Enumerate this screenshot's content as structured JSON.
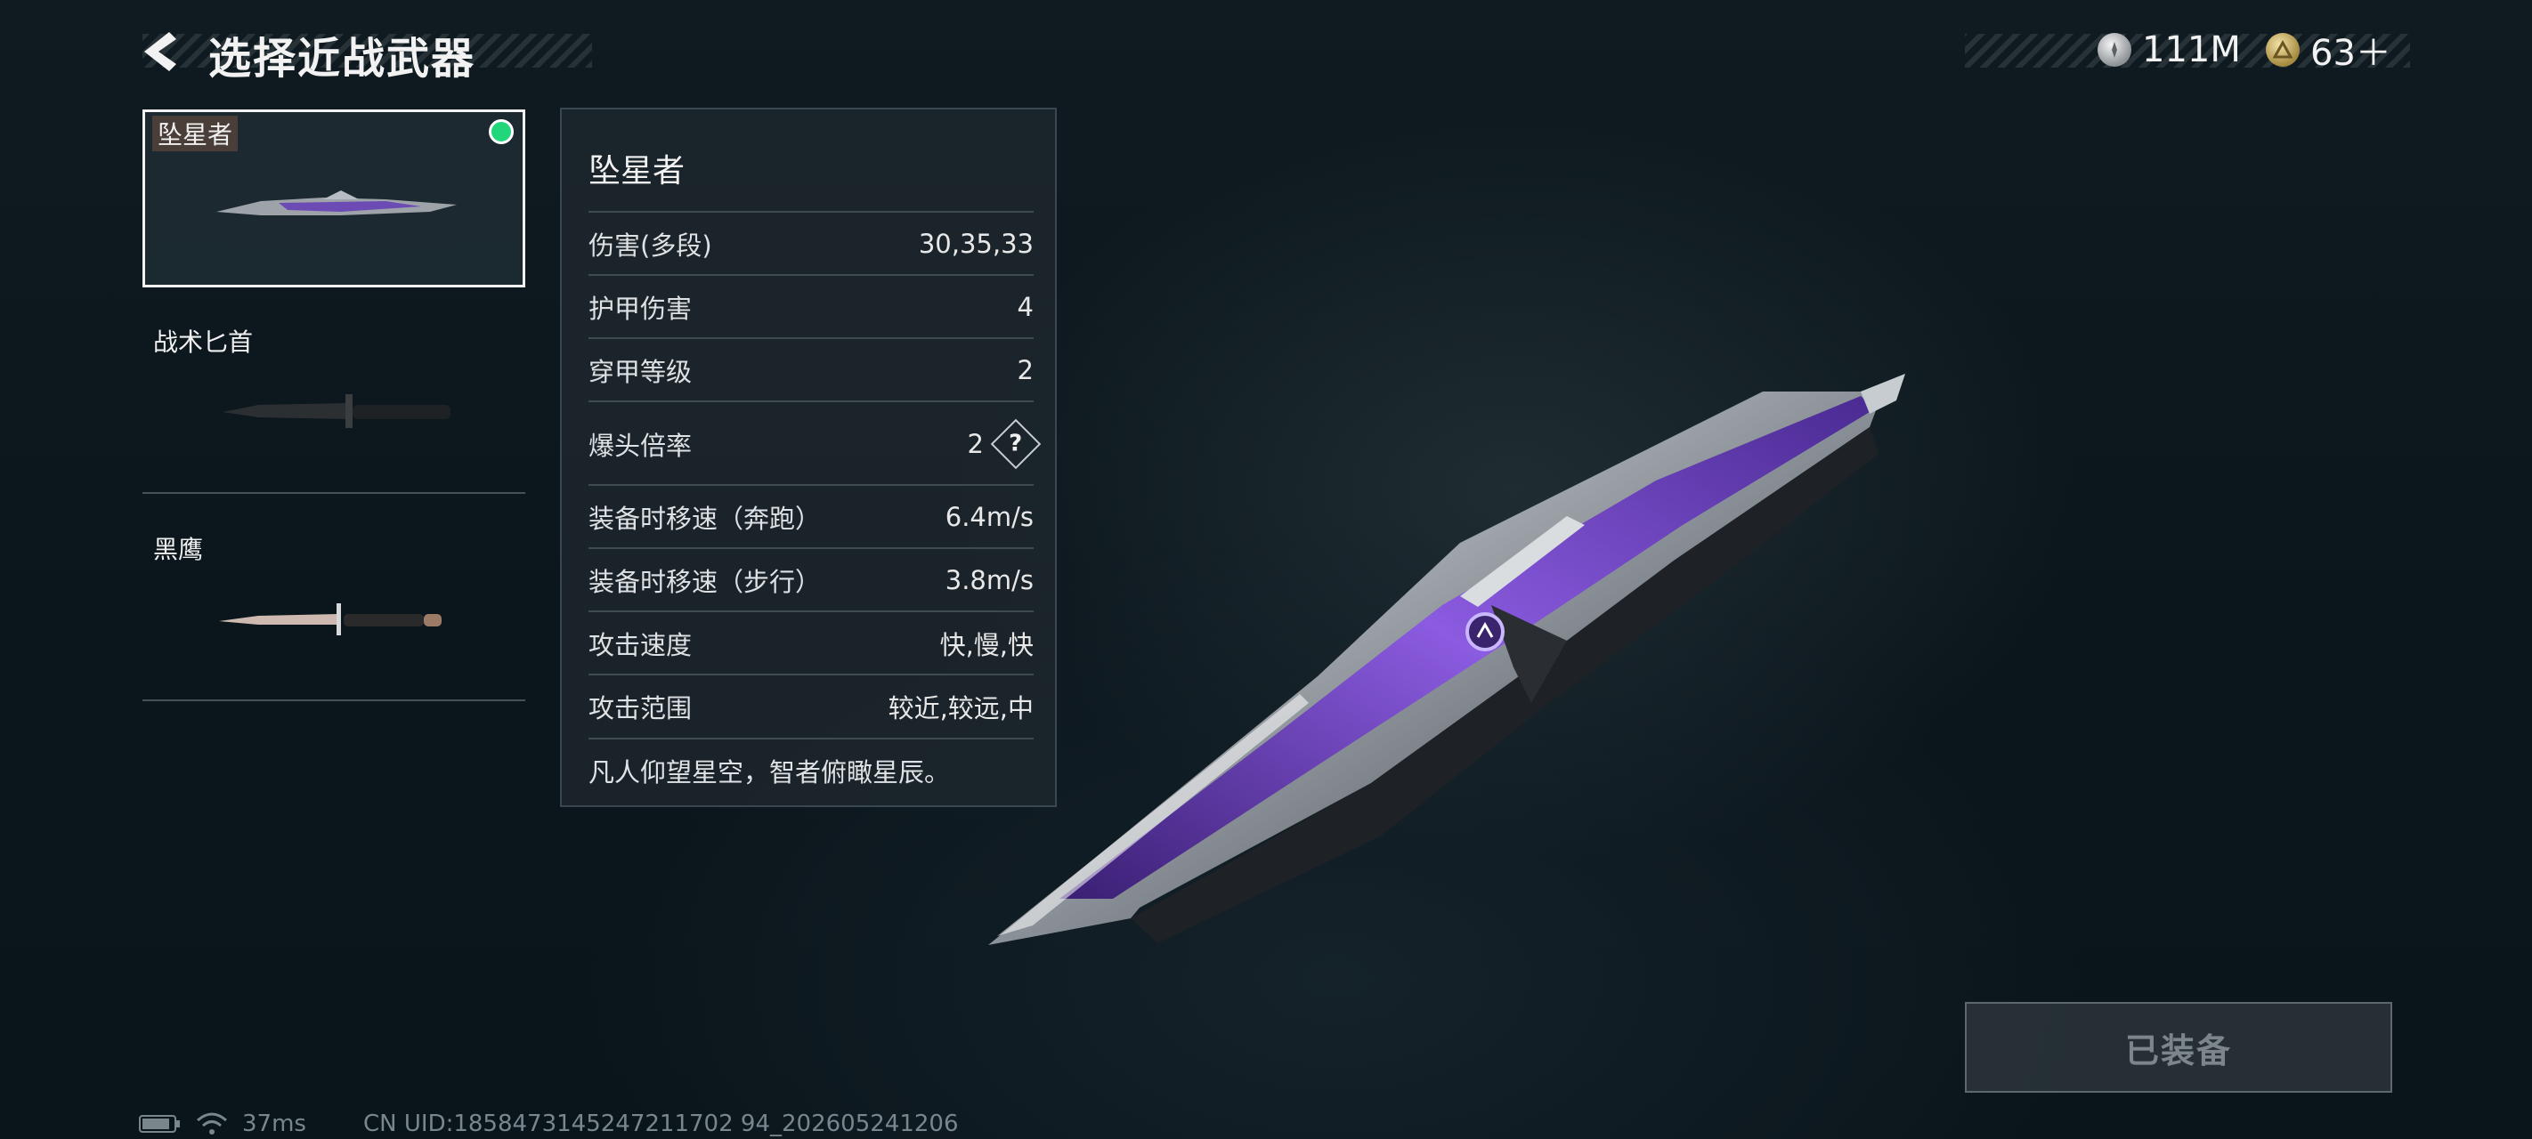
{
  "header": {
    "title": "选择近战武器",
    "back_icon": "chevron-left-icon"
  },
  "currency": [
    {
      "icon": "silver-coin-icon",
      "amount": "111M"
    },
    {
      "icon": "gold-coin-icon",
      "amount": "63＋"
    }
  ],
  "weapons": [
    {
      "name": "坠星者",
      "selected": true,
      "equipped": true
    },
    {
      "name": "战术匕首",
      "selected": false,
      "equipped": false
    },
    {
      "name": "黑鹰",
      "selected": false,
      "equipped": false
    }
  ],
  "stats": {
    "title": "坠星者",
    "rows": [
      {
        "label": "伤害(多段)",
        "value": "30,35,33"
      },
      {
        "label": "护甲伤害",
        "value": "4"
      },
      {
        "label": "穿甲等级",
        "value": "2"
      },
      {
        "label": "爆头倍率",
        "value": "2"
      },
      {
        "label": "装备时移速（奔跑）",
        "value": "6.4m/s"
      },
      {
        "label": "装备时移速（步行）",
        "value": "3.8m/s"
      },
      {
        "label": "攻击速度",
        "value": "快,慢,快"
      },
      {
        "label": "攻击范围",
        "value": "较近,较远,中"
      }
    ],
    "help_symbol": "?",
    "flavor": "凡人仰望星空，智者俯瞰星辰。"
  },
  "equip_button": {
    "label": "已装备"
  },
  "footer": {
    "ping": "37ms",
    "uid": "CN UID:1858473145247211702 94_202605241206"
  },
  "colors": {
    "background": "#0d1a20",
    "equipped_dot": "#22d77b",
    "blade_accent": "#7a4bd6"
  }
}
